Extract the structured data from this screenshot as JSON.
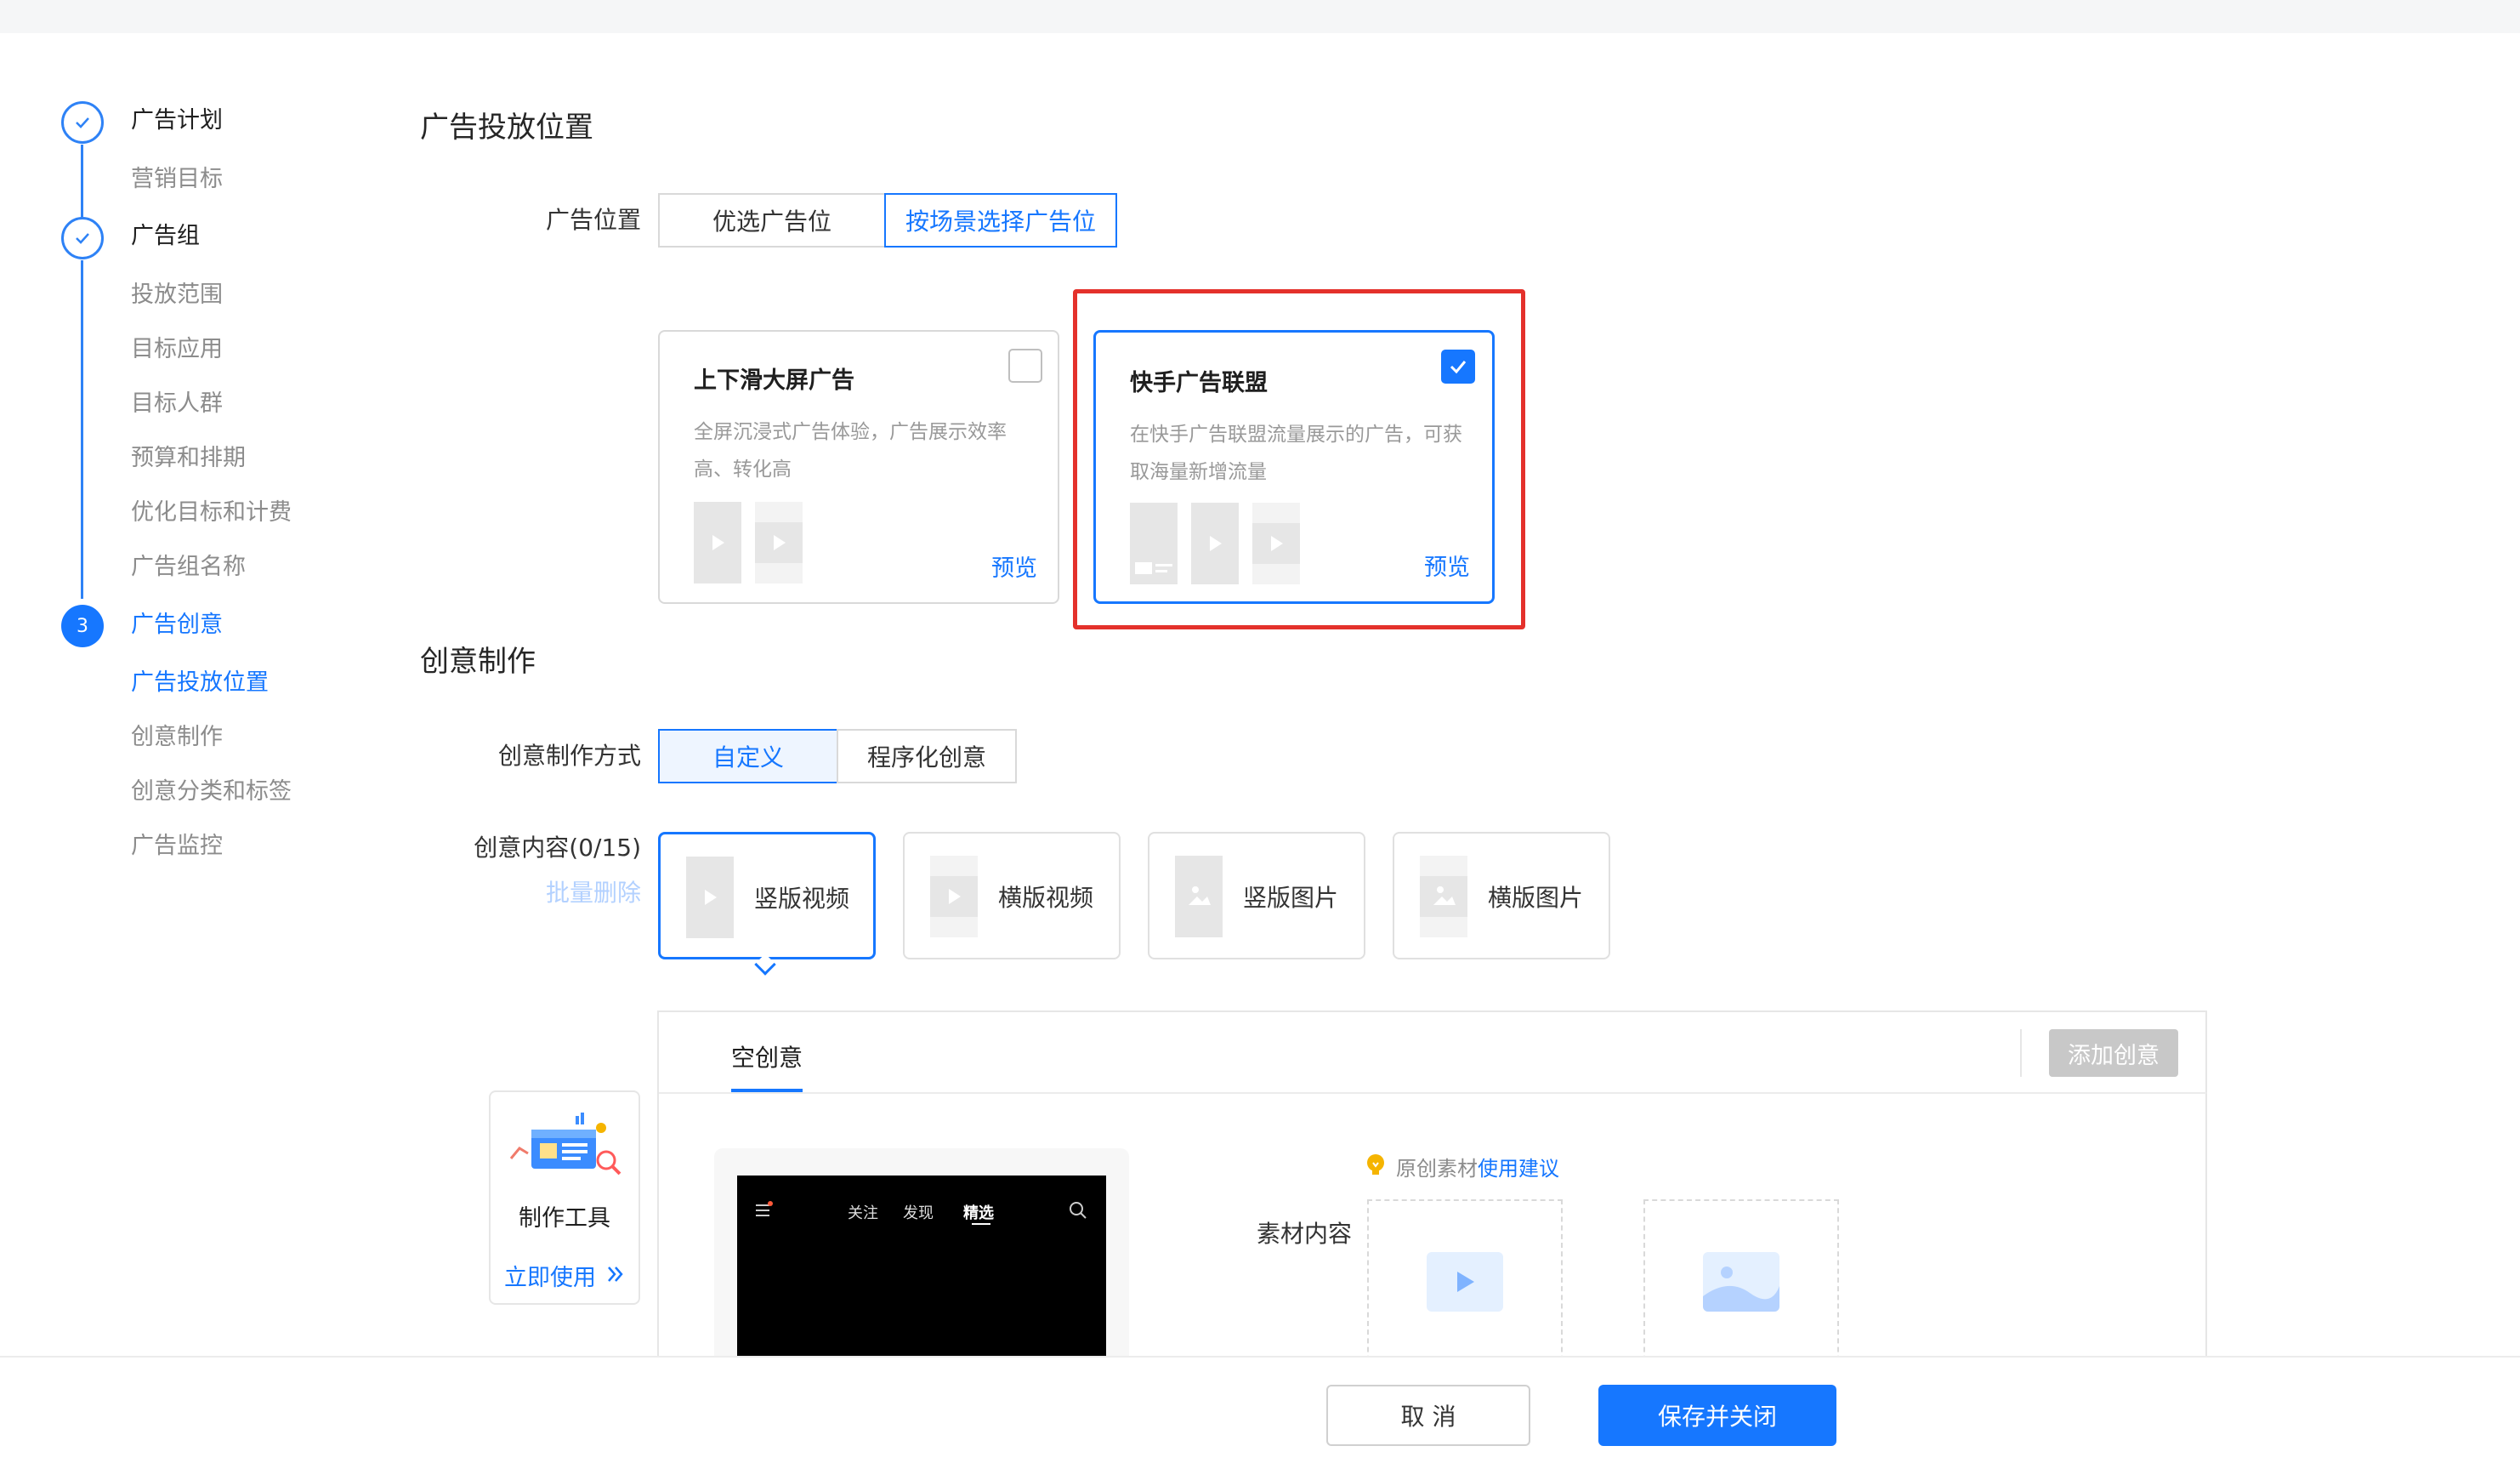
{
  "steps": {
    "plan": {
      "title": "广告计划",
      "subs": [
        "营销目标"
      ]
    },
    "group": {
      "title": "广告组",
      "subs": [
        "投放范围",
        "目标应用",
        "目标人群",
        "预算和排期",
        "优化目标和计费",
        "广告组名称"
      ]
    },
    "creative": {
      "number": "3",
      "title": "广告创意",
      "subs": [
        "广告投放位置",
        "创意制作",
        "创意分类和标签",
        "广告监控"
      ]
    }
  },
  "placement": {
    "section_title": "广告投放位置",
    "label": "广告位置",
    "options": [
      "优选广告位",
      "按场景选择广告位"
    ],
    "cards": [
      {
        "title": "上下滑大屏广告",
        "desc": "全屏沉浸式广告体验，广告展示效率高、转化高",
        "preview": "预览",
        "checked": false
      },
      {
        "title": "快手广告联盟",
        "desc": "在快手广告联盟流量展示的广告，可获取海量新增流量",
        "preview": "预览",
        "checked": true
      }
    ]
  },
  "creative": {
    "section_title": "创意制作",
    "method_label": "创意制作方式",
    "methods": [
      "自定义",
      "程序化创意"
    ],
    "content_label": "创意内容(0/15)",
    "batch_delete": "批量删除",
    "types": [
      "竖版视频",
      "横版视频",
      "竖版图片",
      "横版图片"
    ],
    "tab": "空创意",
    "add_button": "添加创意",
    "hint_prefix": "原创素材",
    "hint_link": "使用建议",
    "material_label": "素材内容",
    "phone_tabs": [
      "关注",
      "发现",
      "精选"
    ]
  },
  "tool": {
    "title": "制作工具",
    "link": "立即使用"
  },
  "footer": {
    "cancel": "取 消",
    "save": "保存并关闭"
  },
  "colors": {
    "accent": "#1677ff",
    "highlight_box": "#e4312b"
  }
}
